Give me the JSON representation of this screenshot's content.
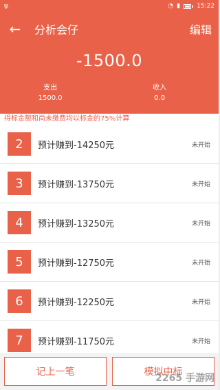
{
  "statusbar": {
    "left_icon": "usb-icon",
    "time": "15:22"
  },
  "header": {
    "title": "分析会仔",
    "edit_label": "编辑",
    "balance": "-1500.0"
  },
  "stats": [
    {
      "label": "支出",
      "value": "1500.0"
    },
    {
      "label": "收入",
      "value": "0.0"
    }
  ],
  "notice": "得标金额和尚未缴费均以标金的75%计算",
  "rows": [
    {
      "num": "2",
      "text": "预计赚到-14250元",
      "status": "未开始"
    },
    {
      "num": "3",
      "text": "预计赚到-13750元",
      "status": "未开始"
    },
    {
      "num": "4",
      "text": "预计赚到-13250元",
      "status": "未开始"
    },
    {
      "num": "5",
      "text": "预计赚到-12750元",
      "status": "未开始"
    },
    {
      "num": "6",
      "text": "预计赚到-12250元",
      "status": "未开始"
    },
    {
      "num": "7",
      "text": "预计赚到-11750元",
      "status": "未开始"
    }
  ],
  "buttons": {
    "record": "记上一笔",
    "simulate": "模拟中标"
  },
  "watermark": "2265 手游网",
  "colors": {
    "accent": "#e96148"
  }
}
